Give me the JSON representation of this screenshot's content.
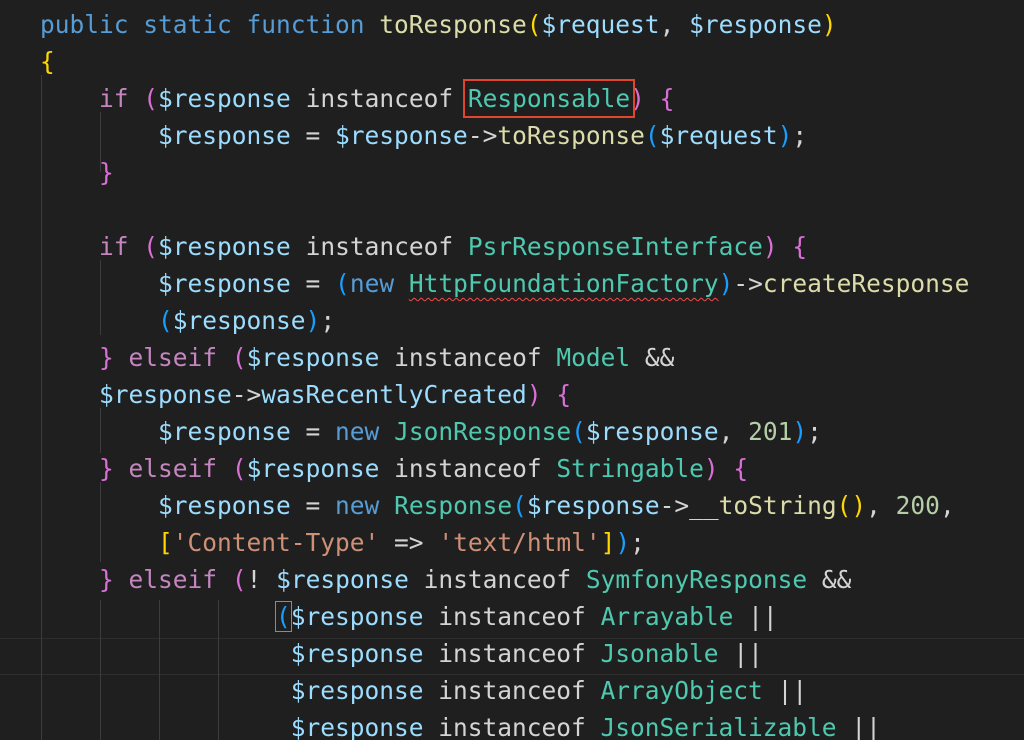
{
  "editor": {
    "language": "php",
    "highlighted_token": "Responsable",
    "error_token": "HttpFoundationFactory",
    "colors": {
      "background": "#1f1f1f",
      "keyword": "#569cd6",
      "control": "#c586c0",
      "function": "#dcdcaa",
      "variable": "#9cdcfe",
      "class": "#4ec9b0",
      "string": "#ce9178",
      "number": "#b5cea8",
      "highlight_box": "#e0452e"
    },
    "lines": [
      [
        {
          "t": "kw",
          "v": "public static function "
        },
        {
          "t": "fn",
          "v": "toResponse"
        },
        {
          "t": "b1",
          "v": "("
        },
        {
          "t": "var",
          "v": "$request"
        },
        {
          "t": "op",
          "v": ", "
        },
        {
          "t": "var",
          "v": "$response"
        },
        {
          "t": "b1",
          "v": ")"
        }
      ],
      [
        {
          "t": "b1",
          "v": "{"
        }
      ],
      [
        {
          "t": "op",
          "v": "    "
        },
        {
          "t": "ctl",
          "v": "if "
        },
        {
          "t": "b2",
          "v": "("
        },
        {
          "t": "var",
          "v": "$response"
        },
        {
          "t": "op",
          "v": " instanceof "
        },
        {
          "t": "cls",
          "v": "Responsable",
          "box": true
        },
        {
          "t": "b2",
          "v": ")"
        },
        {
          "t": "op",
          "v": " "
        },
        {
          "t": "b2",
          "v": "{"
        }
      ],
      [
        {
          "t": "op",
          "v": "        "
        },
        {
          "t": "var",
          "v": "$response"
        },
        {
          "t": "op",
          "v": " = "
        },
        {
          "t": "var",
          "v": "$response"
        },
        {
          "t": "op",
          "v": "->"
        },
        {
          "t": "fn",
          "v": "toResponse"
        },
        {
          "t": "b3",
          "v": "("
        },
        {
          "t": "var",
          "v": "$request"
        },
        {
          "t": "b3",
          "v": ")"
        },
        {
          "t": "op",
          "v": ";"
        }
      ],
      [
        {
          "t": "op",
          "v": "    "
        },
        {
          "t": "b2",
          "v": "}"
        }
      ],
      [],
      [
        {
          "t": "op",
          "v": "    "
        },
        {
          "t": "ctl",
          "v": "if "
        },
        {
          "t": "b2",
          "v": "("
        },
        {
          "t": "var",
          "v": "$response"
        },
        {
          "t": "op",
          "v": " instanceof "
        },
        {
          "t": "cls",
          "v": "PsrResponseInterface"
        },
        {
          "t": "b2",
          "v": ")"
        },
        {
          "t": "op",
          "v": " "
        },
        {
          "t": "b2",
          "v": "{"
        }
      ],
      [
        {
          "t": "op",
          "v": "        "
        },
        {
          "t": "var",
          "v": "$response"
        },
        {
          "t": "op",
          "v": " = "
        },
        {
          "t": "b3",
          "v": "("
        },
        {
          "t": "kw",
          "v": "new "
        },
        {
          "t": "cls",
          "v": "HttpFoundationFactory",
          "squiggle": true
        },
        {
          "t": "b3",
          "v": ")"
        },
        {
          "t": "op",
          "v": "->"
        },
        {
          "t": "fn",
          "v": "createResponse"
        }
      ],
      [
        {
          "t": "op",
          "v": "        "
        },
        {
          "t": "b3",
          "v": "("
        },
        {
          "t": "var",
          "v": "$response"
        },
        {
          "t": "b3",
          "v": ")"
        },
        {
          "t": "op",
          "v": ";"
        }
      ],
      [
        {
          "t": "op",
          "v": "    "
        },
        {
          "t": "b2",
          "v": "}"
        },
        {
          "t": "op",
          "v": " "
        },
        {
          "t": "ctl",
          "v": "elseif "
        },
        {
          "t": "b2",
          "v": "("
        },
        {
          "t": "var",
          "v": "$response"
        },
        {
          "t": "op",
          "v": " instanceof "
        },
        {
          "t": "cls",
          "v": "Model"
        },
        {
          "t": "op",
          "v": " &&"
        }
      ],
      [
        {
          "t": "op",
          "v": "    "
        },
        {
          "t": "var",
          "v": "$response"
        },
        {
          "t": "op",
          "v": "->"
        },
        {
          "t": "var",
          "v": "wasRecentlyCreated"
        },
        {
          "t": "b2",
          "v": ")"
        },
        {
          "t": "op",
          "v": " "
        },
        {
          "t": "b2",
          "v": "{"
        }
      ],
      [
        {
          "t": "op",
          "v": "        "
        },
        {
          "t": "var",
          "v": "$response"
        },
        {
          "t": "op",
          "v": " = "
        },
        {
          "t": "kw",
          "v": "new "
        },
        {
          "t": "cls",
          "v": "JsonResponse"
        },
        {
          "t": "b3",
          "v": "("
        },
        {
          "t": "var",
          "v": "$response"
        },
        {
          "t": "op",
          "v": ", "
        },
        {
          "t": "num",
          "v": "201"
        },
        {
          "t": "b3",
          "v": ")"
        },
        {
          "t": "op",
          "v": ";"
        }
      ],
      [
        {
          "t": "op",
          "v": "    "
        },
        {
          "t": "b2",
          "v": "}"
        },
        {
          "t": "op",
          "v": " "
        },
        {
          "t": "ctl",
          "v": "elseif "
        },
        {
          "t": "b2",
          "v": "("
        },
        {
          "t": "var",
          "v": "$response"
        },
        {
          "t": "op",
          "v": " instanceof "
        },
        {
          "t": "cls",
          "v": "Stringable"
        },
        {
          "t": "b2",
          "v": ")"
        },
        {
          "t": "op",
          "v": " "
        },
        {
          "t": "b2",
          "v": "{"
        }
      ],
      [
        {
          "t": "op",
          "v": "        "
        },
        {
          "t": "var",
          "v": "$response"
        },
        {
          "t": "op",
          "v": " = "
        },
        {
          "t": "kw",
          "v": "new "
        },
        {
          "t": "cls",
          "v": "Response"
        },
        {
          "t": "b3",
          "v": "("
        },
        {
          "t": "var",
          "v": "$response"
        },
        {
          "t": "op",
          "v": "->"
        },
        {
          "t": "fn",
          "v": "__toString"
        },
        {
          "t": "b1",
          "v": "()"
        },
        {
          "t": "op",
          "v": ", "
        },
        {
          "t": "num",
          "v": "200"
        },
        {
          "t": "op",
          "v": ","
        }
      ],
      [
        {
          "t": "op",
          "v": "        "
        },
        {
          "t": "b1",
          "v": "["
        },
        {
          "t": "str",
          "v": "'Content-Type'"
        },
        {
          "t": "op",
          "v": " => "
        },
        {
          "t": "str",
          "v": "'text/html'"
        },
        {
          "t": "b1",
          "v": "]"
        },
        {
          "t": "b3",
          "v": ")"
        },
        {
          "t": "op",
          "v": ";"
        }
      ],
      [
        {
          "t": "op",
          "v": "    "
        },
        {
          "t": "b2",
          "v": "}"
        },
        {
          "t": "op",
          "v": " "
        },
        {
          "t": "ctl",
          "v": "elseif "
        },
        {
          "t": "b2",
          "v": "("
        },
        {
          "t": "op",
          "v": "! "
        },
        {
          "t": "var",
          "v": "$response"
        },
        {
          "t": "op",
          "v": " instanceof "
        },
        {
          "t": "cls",
          "v": "SymfonyResponse"
        },
        {
          "t": "op",
          "v": " &&"
        }
      ],
      [
        {
          "t": "op",
          "v": "                "
        },
        {
          "t": "b3",
          "v": "(",
          "match": true
        },
        {
          "t": "var",
          "v": "$response"
        },
        {
          "t": "op",
          "v": " instanceof "
        },
        {
          "t": "cls",
          "v": "Arrayable"
        },
        {
          "t": "op",
          "v": " ||"
        }
      ],
      [
        {
          "t": "op",
          "v": "                 "
        },
        {
          "t": "var",
          "v": "$response"
        },
        {
          "t": "op",
          "v": " instanceof "
        },
        {
          "t": "cls",
          "v": "Jsonable"
        },
        {
          "t": "op",
          "v": " ||"
        }
      ],
      [
        {
          "t": "op",
          "v": "                 "
        },
        {
          "t": "var",
          "v": "$response"
        },
        {
          "t": "op",
          "v": " instanceof "
        },
        {
          "t": "cls",
          "v": "ArrayObject"
        },
        {
          "t": "op",
          "v": " ||"
        }
      ],
      [
        {
          "t": "op",
          "v": "                 "
        },
        {
          "t": "var",
          "v": "$response"
        },
        {
          "t": "op",
          "v": " instanceof "
        },
        {
          "t": "cls",
          "v": "JsonSerializable"
        },
        {
          "t": "op",
          "v": " ||"
        }
      ]
    ]
  }
}
